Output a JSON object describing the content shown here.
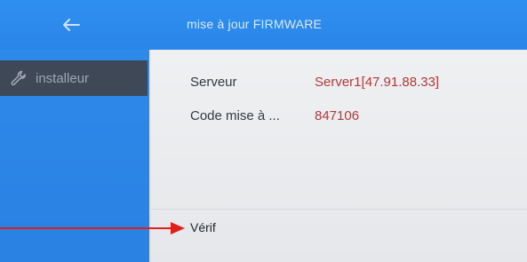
{
  "header": {
    "title": "mise à jour FIRMWARE",
    "back_icon": "arrow-left-icon"
  },
  "sidebar": {
    "items": [
      {
        "label": "installeur",
        "icon": "wrench-icon",
        "selected": true
      }
    ]
  },
  "fields": [
    {
      "label": "Serveur",
      "value": "Server1[47.91.88.33]"
    },
    {
      "label": "Code mise à ...",
      "value": "847106"
    }
  ],
  "actions": {
    "verify_label": "Vérif"
  },
  "annotation": {
    "icon": "red-arrow-pointer",
    "color": "#e0201a"
  },
  "colors": {
    "titlebar": "#2f8ff0",
    "sidebar": "#2d89ea",
    "selected_item": "#3f4856",
    "value_text": "#b33b3b"
  }
}
